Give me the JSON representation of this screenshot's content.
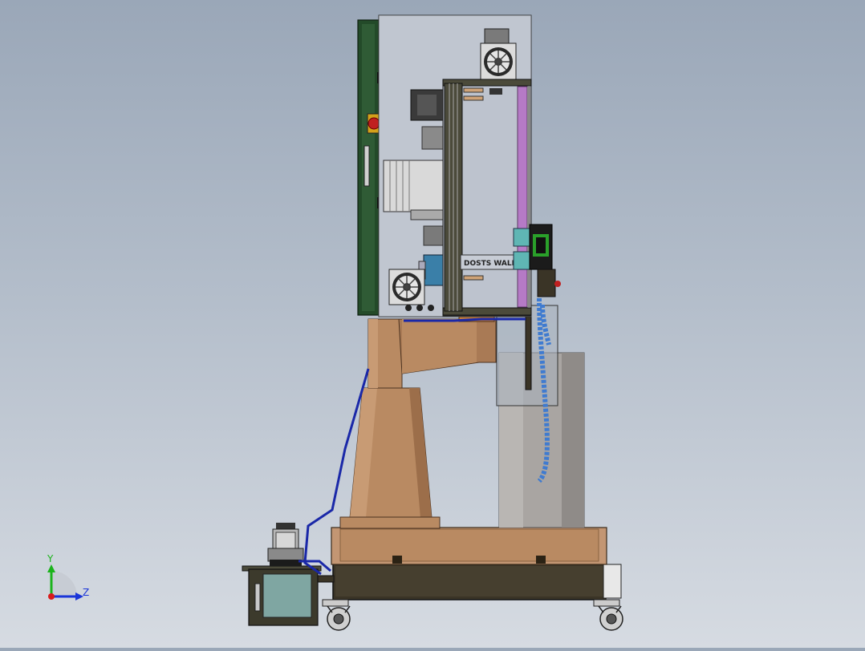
{
  "model_text": {
    "panel_label": "DOSTS WALL"
  },
  "triad": {
    "y_label": "Y",
    "z_label": "Z",
    "colors": {
      "y": "#1bb31b",
      "z": "#1a35d8",
      "x": "#d81b1b"
    }
  },
  "colors": {
    "background_top": "#9aa7b8",
    "background_bottom": "#d6dbe2",
    "cabinet": "#c4c9d3",
    "door": "#244f2a",
    "frame": "#4b4a3a",
    "copper": "#b98a62",
    "copper_dark": "#9c6e4a",
    "column_grey": "#a7a3a0",
    "hose_blue": "#1a28a8",
    "coolant_blue": "#3f7bd0",
    "rail_purple": "#b57ac6",
    "teal": "#5fb6b4"
  }
}
